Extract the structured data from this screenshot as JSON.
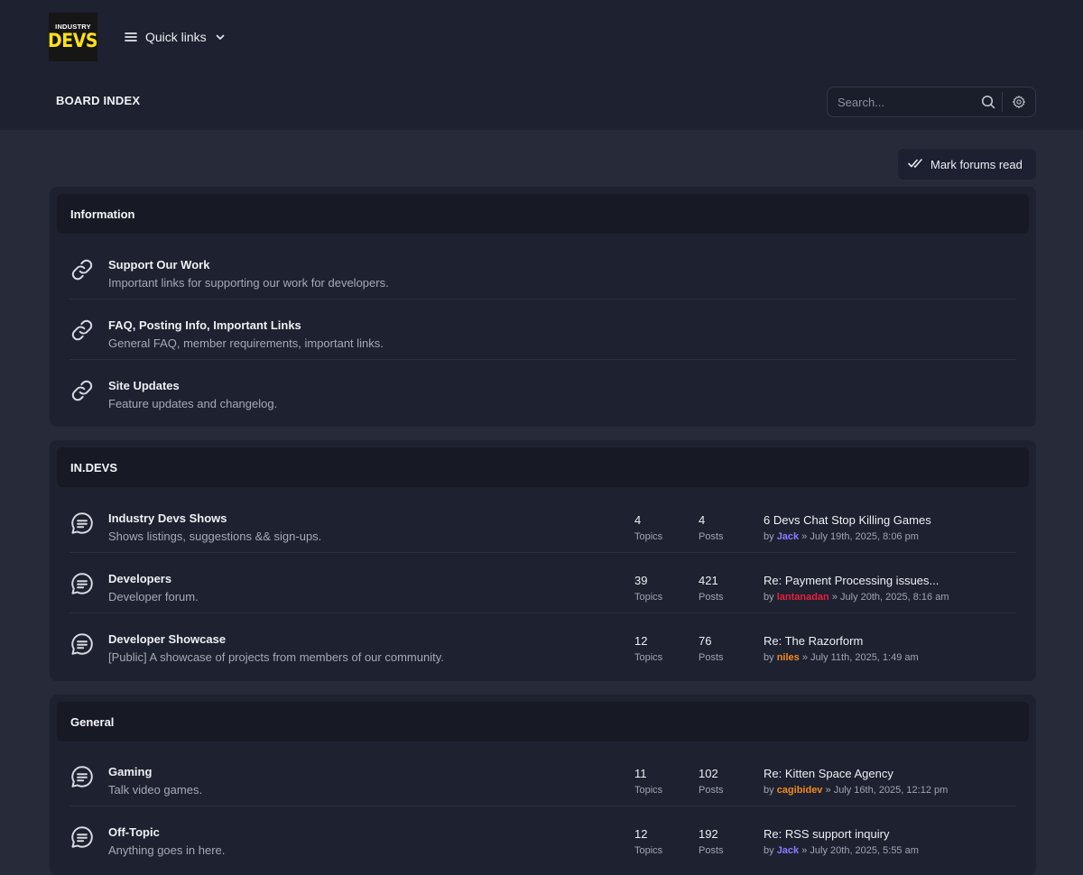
{
  "header": {
    "logo": {
      "line1": "INDUSTRY",
      "line2": "DEVS",
      "accent": "#ffe01b"
    },
    "quick_links": "Quick links",
    "breadcrumb": "BOARD INDEX",
    "search": {
      "placeholder": "Search...",
      "icon": "search-icon",
      "settings_icon": "gear-icon"
    }
  },
  "mark_read": {
    "label": "Mark forums read",
    "icon": "double-check-icon"
  },
  "categories": [
    {
      "title": "Information",
      "forums": [
        {
          "title": "Support Our Work",
          "desc": "Important links for supporting our work for developers.",
          "icon": "link-icon"
        },
        {
          "title": "FAQ, Posting Info, Important Links",
          "desc": "General FAQ, member requirements, important links.",
          "icon": "link-icon"
        },
        {
          "title": "Site Updates",
          "desc": "Feature updates and changelog.",
          "icon": "link-icon"
        }
      ]
    },
    {
      "title": "IN.DEVS",
      "forums": [
        {
          "title": "Industry Devs Shows",
          "desc": "Shows listings, suggestions && sign-ups.",
          "icon": "chat-bubble-icon",
          "topics": "4",
          "posts": "4",
          "last": {
            "title": "6 Devs Chat Stop Killing Games",
            "by": "by",
            "user": "Jack",
            "user_color": "#8b7bff",
            "sep": "»",
            "date": "July 19th, 2025, 8:06 pm"
          }
        },
        {
          "title": "Developers",
          "desc": "Developer forum.",
          "icon": "chat-bubble-icon",
          "topics": "39",
          "posts": "421",
          "last": {
            "title": "Re: Payment Processing issues...",
            "by": "by",
            "user": "lantanadan",
            "user_color": "#e8203a",
            "sep": "»",
            "date": "July 20th, 2025, 8:16 am"
          }
        },
        {
          "title": "Developer Showcase",
          "desc": "[Public] A showcase of projects from members of our community.",
          "icon": "chat-bubble-icon",
          "topics": "12",
          "posts": "76",
          "last": {
            "title": "Re: The Razorform",
            "by": "by",
            "user": "niles",
            "user_color": "#f58a1f",
            "sep": "»",
            "date": "July 11th, 2025, 1:49 am"
          }
        }
      ]
    },
    {
      "title": "General",
      "forums": [
        {
          "title": "Gaming",
          "desc": "Talk video games.",
          "icon": "chat-bubble-icon",
          "topics": "11",
          "posts": "102",
          "last": {
            "title": "Re: Kitten Space Agency",
            "by": "by",
            "user": "cagibidev",
            "user_color": "#f58a1f",
            "sep": "»",
            "date": "July 16th, 2025, 12:12 pm"
          }
        },
        {
          "title": "Off-Topic",
          "desc": "Anything goes in here.",
          "icon": "chat-bubble-icon",
          "topics": "12",
          "posts": "192",
          "last": {
            "title": "Re: RSS support inquiry",
            "by": "by",
            "user": "Jack",
            "user_color": "#8b7bff",
            "sep": "»",
            "date": "July 20th, 2025, 5:55 am"
          }
        }
      ]
    }
  ],
  "labels": {
    "topics": "Topics",
    "posts": "Posts"
  }
}
